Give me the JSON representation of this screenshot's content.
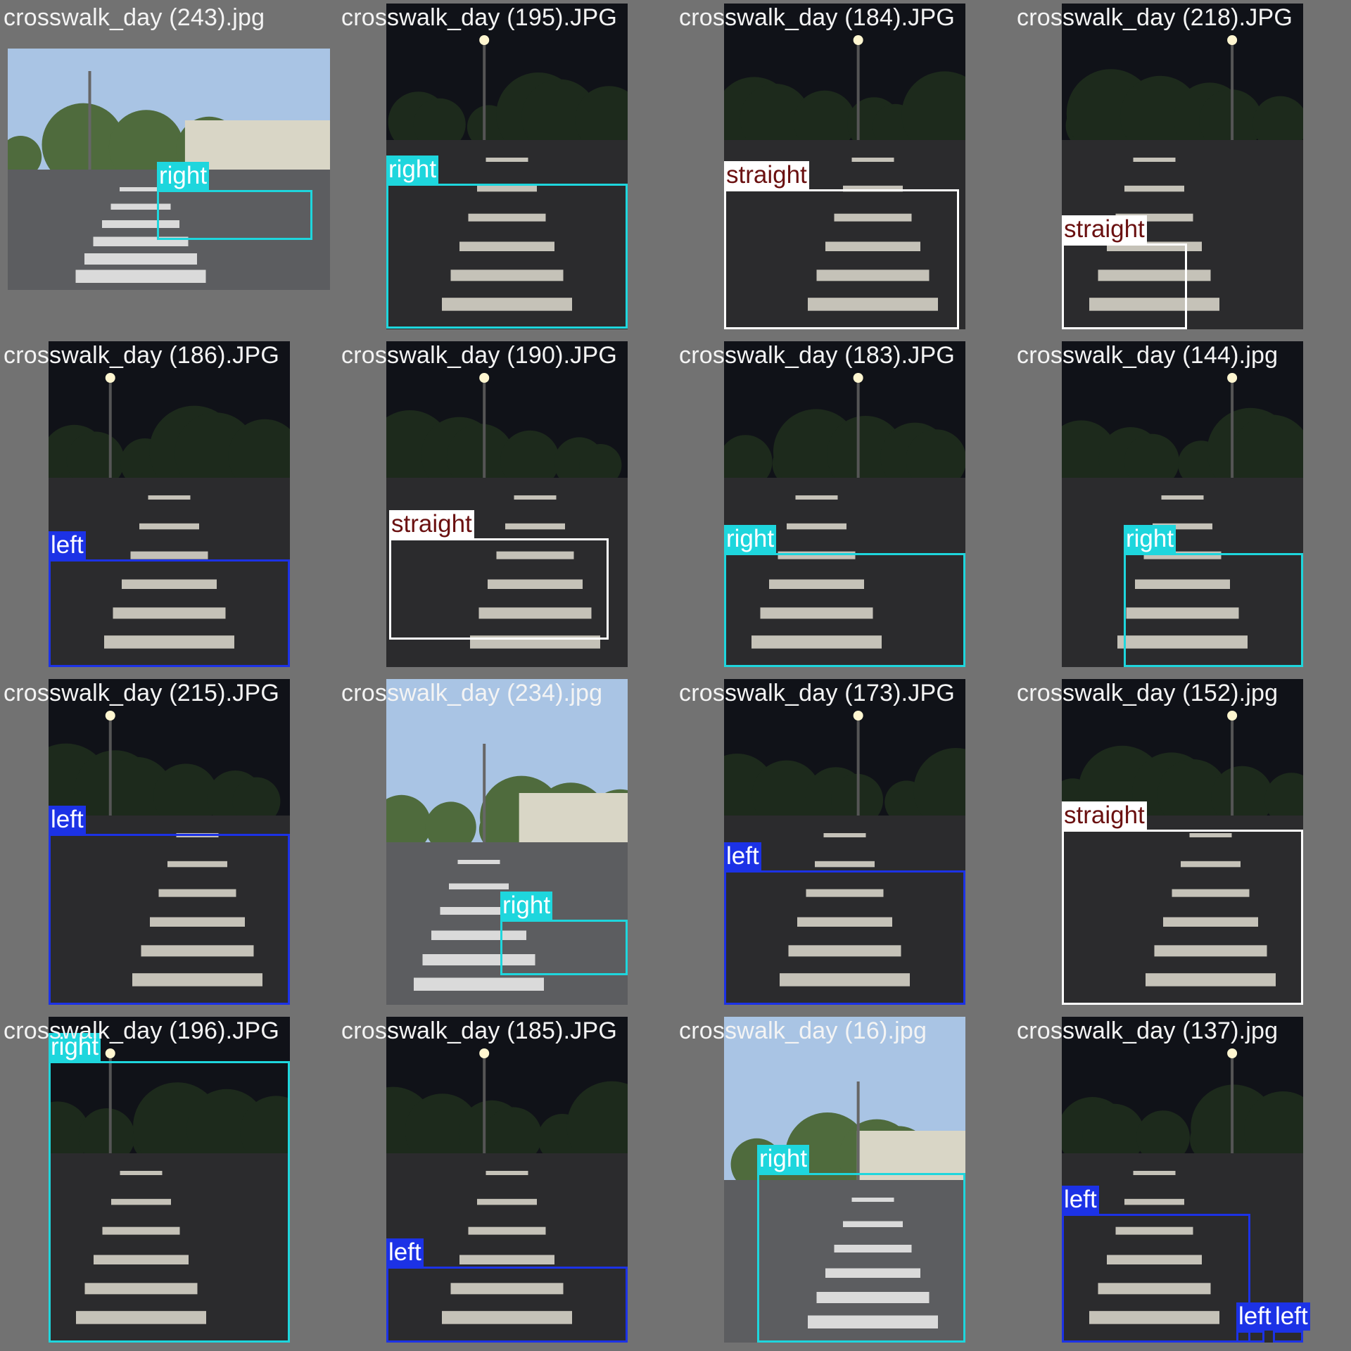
{
  "colors": {
    "right": "#1ed6dd",
    "left": "#1c32e6",
    "straight": "#ffffff",
    "straight_text": "#6a1010",
    "label_text": "#ffffff"
  },
  "tiles": [
    {
      "file": "crosswalk_day (243).jpg",
      "scene": "day",
      "detections": [
        {
          "cls": "right",
          "conf_shown": false
        }
      ]
    },
    {
      "file": "crosswalk_day (195).JPG",
      "scene": "night",
      "detections": [
        {
          "cls": "right"
        }
      ]
    },
    {
      "file": "crosswalk_day (184).JPG",
      "scene": "night",
      "detections": [
        {
          "cls": "straight"
        }
      ]
    },
    {
      "file": "crosswalk_day (218).JPG",
      "scene": "night",
      "detections": [
        {
          "cls": "straight"
        }
      ]
    },
    {
      "file": "crosswalk_day (186).JPG",
      "scene": "night",
      "detections": [
        {
          "cls": "left"
        }
      ]
    },
    {
      "file": "crosswalk_day (190).JPG",
      "scene": "night",
      "detections": [
        {
          "cls": "straight"
        }
      ]
    },
    {
      "file": "crosswalk_day (183).JPG",
      "scene": "night",
      "detections": [
        {
          "cls": "right"
        }
      ]
    },
    {
      "file": "crosswalk_day (144).jpg",
      "scene": "night",
      "detections": [
        {
          "cls": "right"
        }
      ]
    },
    {
      "file": "crosswalk_day (215).JPG",
      "scene": "night",
      "detections": [
        {
          "cls": "left"
        }
      ]
    },
    {
      "file": "crosswalk_day (234).jpg",
      "scene": "day",
      "detections": [
        {
          "cls": "right"
        }
      ]
    },
    {
      "file": "crosswalk_day (173).JPG",
      "scene": "night",
      "detections": [
        {
          "cls": "left"
        }
      ]
    },
    {
      "file": "crosswalk_day (152).jpg",
      "scene": "night",
      "detections": [
        {
          "cls": "straight"
        }
      ]
    },
    {
      "file": "crosswalk_day (196).JPG",
      "scene": "night",
      "detections": [
        {
          "cls": "right"
        }
      ]
    },
    {
      "file": "crosswalk_day (185).JPG",
      "scene": "night",
      "detections": [
        {
          "cls": "left"
        }
      ]
    },
    {
      "file": "crosswalk_day (16).jpg",
      "scene": "day",
      "detections": [
        {
          "cls": "right"
        }
      ]
    },
    {
      "file": "crosswalk_day (137).jpg",
      "scene": "night",
      "detections": [
        {
          "cls": "left"
        },
        {
          "cls": "left"
        },
        {
          "cls": "left"
        }
      ]
    }
  ]
}
